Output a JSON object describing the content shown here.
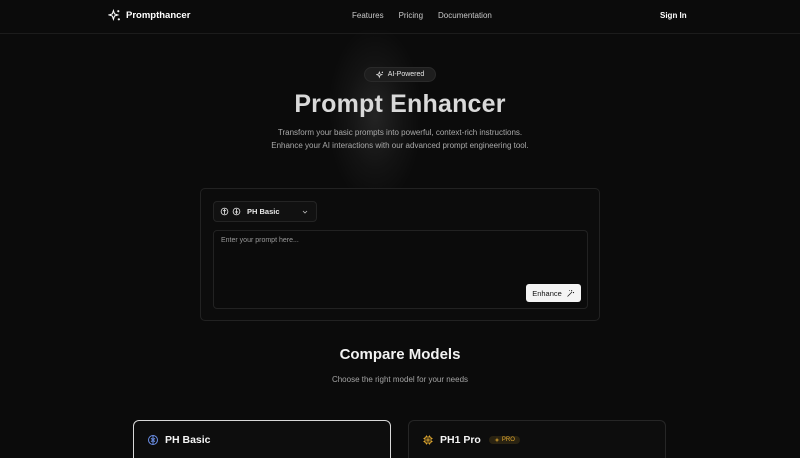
{
  "header": {
    "brand": "Prompthancer",
    "nav": [
      "Features",
      "Pricing",
      "Documentation"
    ],
    "sign_in": "Sign In"
  },
  "hero": {
    "badge": "AI-Powered",
    "title": "Prompt Enhancer",
    "subtitle": "Transform your basic prompts into powerful, context-rich instructions. Enhance your AI interactions with our advanced prompt engineering tool."
  },
  "prompt_card": {
    "model_select": "PH Basic",
    "input_placeholder": "Enter your prompt here...",
    "input_value": "",
    "enhance_button": "Enhance"
  },
  "compare": {
    "title": "Compare Models",
    "subtitle": "Choose the right model for your needs",
    "models": [
      {
        "name": "PH Basic",
        "icon": "brain-icon"
      },
      {
        "name": "PH1 Pro",
        "icon": "chip-icon",
        "badge": "PRO"
      }
    ]
  },
  "colors": {
    "background": "#0b0b0b",
    "pro_accent": "#e0a72e",
    "basic_accent": "#6b8fe8"
  }
}
